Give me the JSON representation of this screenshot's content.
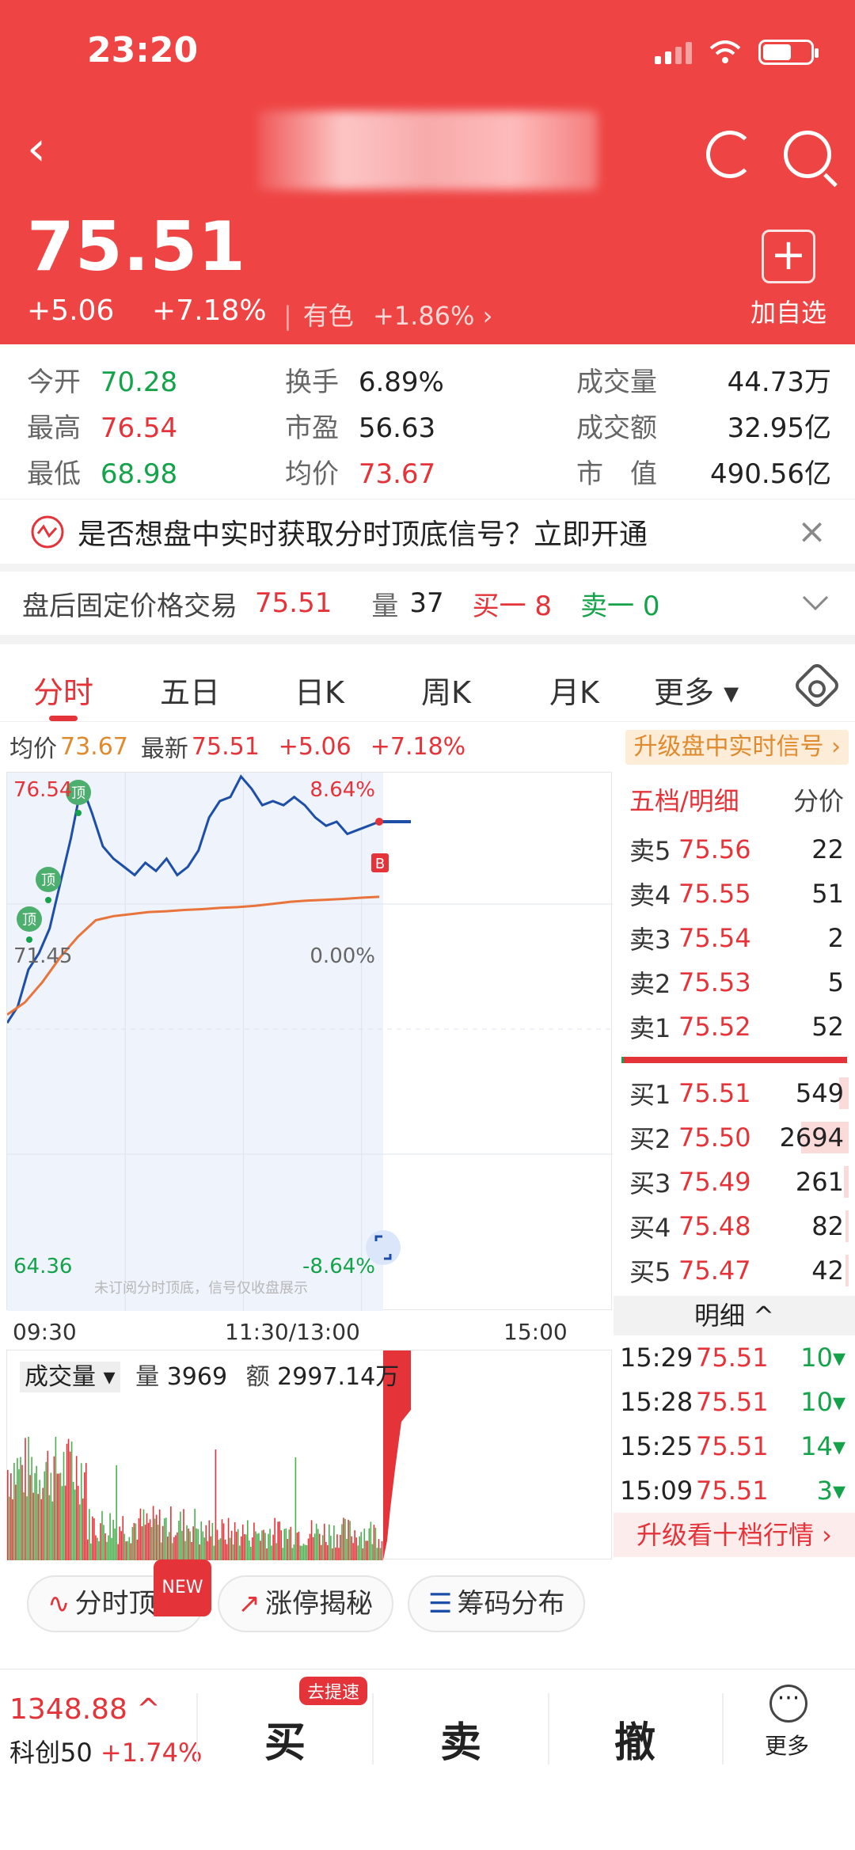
{
  "status_bar": {
    "time": "23:20"
  },
  "header": {
    "price": "75.51",
    "change": "+5.06",
    "change_pct": "+7.18%",
    "sector_name": "有色",
    "sector_change": "+1.86%",
    "sector_arrow": "›",
    "add_watch_symbol": "+",
    "add_watch_label": "加自选",
    "back_symbol": "‹"
  },
  "stats": [
    {
      "label": "今开",
      "value": "70.28",
      "color": "green"
    },
    {
      "label": "最高",
      "value": "76.54",
      "color": "red"
    },
    {
      "label": "最低",
      "value": "68.98",
      "color": "green"
    },
    {
      "label": "换手",
      "value": "6.89%",
      "color": "dark"
    },
    {
      "label": "市盈",
      "value": "56.63",
      "color": "dark"
    },
    {
      "label": "均价",
      "value": "73.67",
      "color": "red"
    },
    {
      "label": "成交量",
      "value": "44.73万",
      "color": "dark"
    },
    {
      "label": "成交额",
      "value": "32.95亿",
      "color": "dark"
    },
    {
      "label": "市　值",
      "value": "490.56亿",
      "color": "dark"
    }
  ],
  "banner": {
    "text": "是否想盘中实时获取分时顶底信号？立即开通",
    "close": "×"
  },
  "after_hours": {
    "title": "盘后固定价格交易",
    "price": "75.51",
    "vol_label": "量",
    "vol": "37",
    "buy": "买一 8",
    "sell": "卖一 0"
  },
  "tabs": [
    "分时",
    "五日",
    "日K",
    "周K",
    "月K",
    "更多 ▾"
  ],
  "info_bar": {
    "avg_label": "均价",
    "avg": "73.67",
    "last_label": "最新",
    "last": "75.51",
    "chg": "+5.06",
    "pct": "+7.18%",
    "upgrade": "升级盘中实时信号 ›"
  },
  "chart_data": {
    "type": "line",
    "y_labels": {
      "high": "76.54",
      "mid": "71.45",
      "low": "64.36"
    },
    "pct_labels": {
      "high": "8.64%",
      "mid": "0.00%",
      "low": "-8.64%"
    },
    "x_labels": [
      "09:30",
      "11:30/13:00",
      "15:00"
    ],
    "ylim": [
      64.36,
      76.54
    ],
    "watermark": "未订阅分时顶底，信号仅收盘展示",
    "signal_labels": [
      "顶",
      "顶",
      "顶"
    ],
    "buy_marker": "B",
    "series": [
      {
        "name": "最新",
        "color": "#1d4ea8",
        "values": [
          70.6,
          71.0,
          71.9,
          72.3,
          72.9,
          74.0,
          75.1,
          76.4,
          75.7,
          74.9,
          74.6,
          74.4,
          74.2,
          74.5,
          74.3,
          74.6,
          74.2,
          74.4,
          74.8,
          75.6,
          76.0,
          76.1,
          76.6,
          76.3,
          75.9,
          76.0,
          75.9,
          76.1,
          75.9,
          75.6,
          75.4,
          75.5,
          75.2,
          75.3,
          75.4,
          75.5
        ]
      },
      {
        "name": "均价",
        "color": "#e8743b",
        "values": [
          70.8,
          71.1,
          71.6,
          72.2,
          72.7,
          73.1,
          73.2,
          73.25,
          73.3,
          73.32,
          73.35,
          73.37,
          73.4,
          73.42,
          73.45,
          73.5,
          73.55,
          73.58,
          73.6,
          73.62,
          73.65,
          73.67
        ]
      }
    ]
  },
  "volume_panel": {
    "label": "成交量",
    "vol_label": "量",
    "vol": "3969",
    "amt_label": "额",
    "amt": "2997.14万"
  },
  "order_book": {
    "header": "五档/明细",
    "header_right": "分价",
    "asks": [
      {
        "label": "卖5",
        "price": "75.56",
        "vol": "22"
      },
      {
        "label": "卖4",
        "price": "75.55",
        "vol": "51"
      },
      {
        "label": "卖3",
        "price": "75.54",
        "vol": "2"
      },
      {
        "label": "卖2",
        "price": "75.53",
        "vol": "5"
      },
      {
        "label": "卖1",
        "price": "75.52",
        "vol": "52"
      }
    ],
    "bids": [
      {
        "label": "买1",
        "price": "75.51",
        "vol": "549",
        "bar": 0.2
      },
      {
        "label": "买2",
        "price": "75.50",
        "vol": "2694",
        "bar": 1.0
      },
      {
        "label": "买3",
        "price": "75.49",
        "vol": "261",
        "bar": 0.1
      },
      {
        "label": "买4",
        "price": "75.48",
        "vol": "82",
        "bar": 0.03
      },
      {
        "label": "买5",
        "price": "75.47",
        "vol": "42",
        "bar": 0.02
      }
    ],
    "detail_label": "明细 ^",
    "ticks": [
      {
        "time": "15:29",
        "price": "75.51",
        "vol": "10▾"
      },
      {
        "time": "15:28",
        "price": "75.51",
        "vol": "10▾"
      },
      {
        "time": "15:25",
        "price": "75.51",
        "vol": "14▾"
      },
      {
        "time": "15:09",
        "price": "75.51",
        "vol": "3▾"
      }
    ],
    "upgrade10": "升级看十档行情 ›"
  },
  "pills": [
    {
      "icon": "∿",
      "label": "分时顶底",
      "tag": "NEW"
    },
    {
      "icon": "↗",
      "label": "涨停揭秘"
    },
    {
      "icon": "☰",
      "label": "筹码分布"
    }
  ],
  "bottom": {
    "index_value": "1348.88 ^",
    "index_name": "科创50",
    "index_change": "+1.74%",
    "buy": "买",
    "quick_tag": "去提速",
    "sell": "卖",
    "cancel": "撤",
    "more": "更多",
    "more_icon": "···"
  }
}
